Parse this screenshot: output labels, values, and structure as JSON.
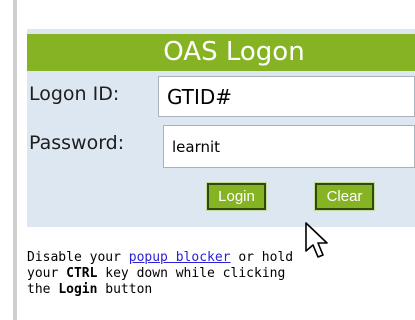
{
  "logon": {
    "title": "OAS Logon",
    "logon_id_label": "Logon ID:",
    "logon_id_value": "GTID#",
    "password_label": "Password:",
    "password_value": "learnit",
    "login_button": "Login",
    "clear_button": "Clear"
  },
  "help": {
    "line1_prefix": "Disable your ",
    "popup_link": "popup blocker",
    "line1_suffix": " or hold",
    "line2_prefix": "your ",
    "ctrl_key": "CTRL",
    "line2_suffix": " key down while clicking",
    "line3_prefix": "the ",
    "login_word": "Login",
    "line3_suffix": " button"
  },
  "icons": {
    "cursor": "mouse-pointer-icon"
  },
  "colors": {
    "title_green": "#86b324",
    "panel_blue": "#dde7f1",
    "link_blue": "#2a1fd6"
  }
}
